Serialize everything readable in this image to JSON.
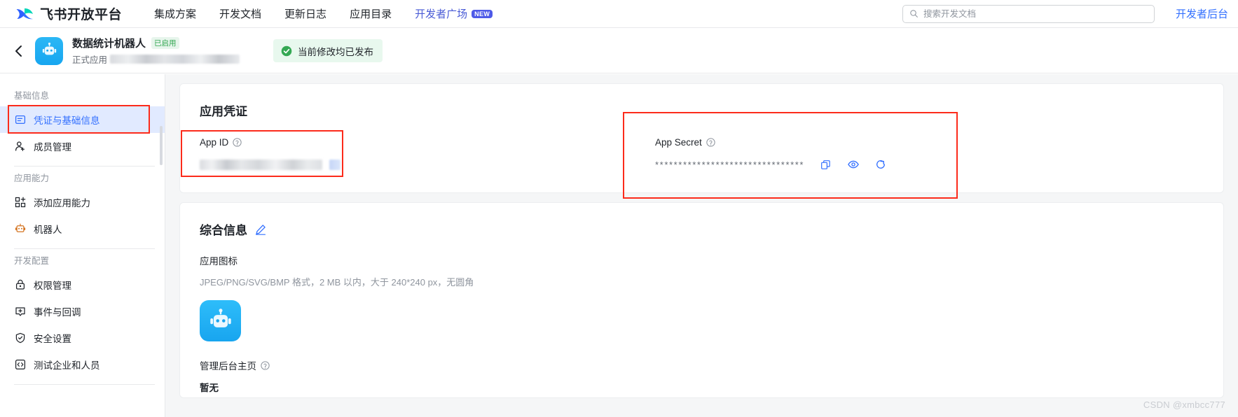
{
  "topnav": {
    "brand": "飞书开放平台",
    "brand_logo_icon": "feishu-logo-icon",
    "items": [
      {
        "label": "集成方案",
        "accent": false
      },
      {
        "label": "开发文档",
        "accent": false
      },
      {
        "label": "更新日志",
        "accent": false
      },
      {
        "label": "应用目录",
        "accent": false
      },
      {
        "label": "开发者广场",
        "accent": true,
        "badge": "NEW"
      }
    ],
    "search": {
      "placeholder": "搜索开发文档",
      "value": "",
      "icon": "search-icon"
    },
    "developer_console": "开发者后台"
  },
  "appheader": {
    "back_icon": "chevron-left-icon",
    "avatar_icon": "robot-avatar-icon",
    "title": "数据统计机器人",
    "status_badge": "已启用",
    "subtitle_prefix": "正式应用",
    "publish_banner": {
      "icon": "check-circle-icon",
      "text": "当前修改均已发布"
    }
  },
  "sidebar": {
    "groups": [
      {
        "title": "基础信息",
        "items": [
          {
            "label": "凭证与基础信息",
            "icon": "credential-icon",
            "active": true
          },
          {
            "label": "成员管理",
            "icon": "user-add-icon",
            "active": false
          }
        ]
      },
      {
        "title": "应用能力",
        "items": [
          {
            "label": "添加应用能力",
            "icon": "grid-add-icon",
            "active": false
          },
          {
            "label": "机器人",
            "icon": "robot-icon",
            "active": false
          }
        ]
      },
      {
        "title": "开发配置",
        "items": [
          {
            "label": "权限管理",
            "icon": "lock-icon",
            "active": false
          },
          {
            "label": "事件与回调",
            "icon": "event-icon",
            "active": false
          },
          {
            "label": "安全设置",
            "icon": "shield-check-icon",
            "active": false
          },
          {
            "label": "测试企业和人员",
            "icon": "code-icon",
            "active": false
          }
        ]
      }
    ]
  },
  "main": {
    "credential_card": {
      "title": "应用凭证",
      "app_id": {
        "label": "App ID",
        "help_icon": "question-circle-icon",
        "value": ""
      },
      "app_secret": {
        "label": "App Secret",
        "help_icon": "question-circle-icon",
        "value": "********************************",
        "actions": [
          {
            "icon": "copy-icon",
            "name": "copy-secret-button"
          },
          {
            "icon": "eye-icon",
            "name": "show-secret-button"
          },
          {
            "icon": "refresh-icon",
            "name": "refresh-secret-button"
          }
        ]
      }
    },
    "info_card": {
      "title": "综合信息",
      "edit_icon": "pencil-edit-icon",
      "app_icon_field": {
        "label": "应用图标",
        "description": "JPEG/PNG/SVG/BMP 格式，2 MB 以内，大于 240*240 px，无圆角",
        "icon": "robot-avatar-icon"
      },
      "admin_home_field": {
        "label": "管理后台主页",
        "help_icon": "question-circle-icon",
        "value": "暂无"
      }
    }
  },
  "watermark": "CSDN @xmbcc777",
  "colors": {
    "accent_blue": "#3370ff",
    "nav_accent": "#4a5bd6",
    "annotation_red": "#fc2b1b",
    "active_bg": "#e1eaff",
    "success_green": "#34a853",
    "banner_bg": "#e8f8ee",
    "page_bg": "#f5f6f7"
  }
}
